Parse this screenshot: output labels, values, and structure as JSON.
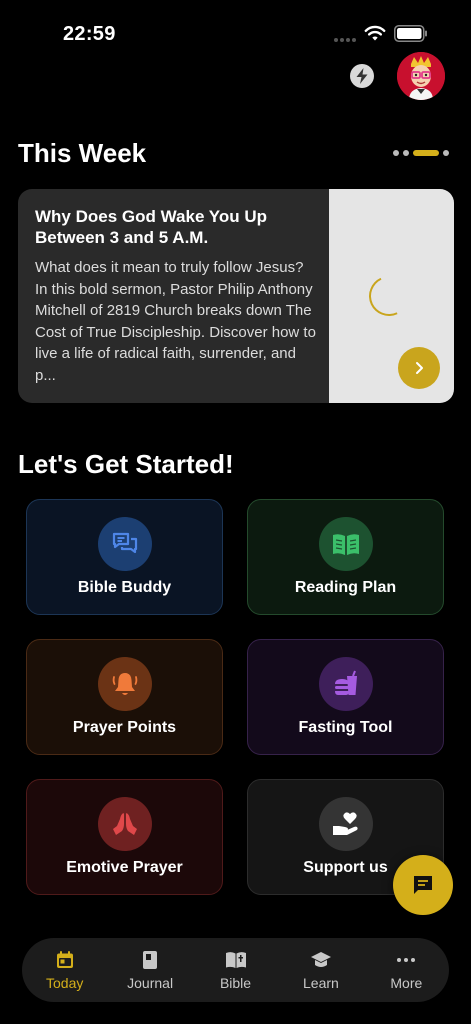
{
  "status_bar": {
    "time": "22:59"
  },
  "header": {
    "bolt_icon": "bolt-icon",
    "avatar_icon": "user-avatar"
  },
  "this_week": {
    "title": "This Week",
    "card": {
      "title": "Why Does God Wake You Up Between 3 and 5 A.M.",
      "description": "What does it mean to truly follow Jesus? In this bold sermon, Pastor Philip Anthony Mitchell of 2819 Church breaks down The Cost of True Discipleship. Discover how to live a life of radical faith, surrender, and p..."
    }
  },
  "get_started": {
    "title": "Let's Get Started!",
    "tiles": [
      {
        "label": "Bible Buddy",
        "icon": "chat-bubbles-icon",
        "color": "#3b6fd6"
      },
      {
        "label": "Reading Plan",
        "icon": "open-book-icon",
        "color": "#3bbf6a"
      },
      {
        "label": "Prayer Points",
        "icon": "bell-icon",
        "color": "#f07a3a"
      },
      {
        "label": "Fasting Tool",
        "icon": "fasting-food-icon",
        "color": "#a55be0"
      },
      {
        "label": "Emotive Prayer",
        "icon": "praying-hands-icon",
        "color": "#e0484a"
      },
      {
        "label": "Support us",
        "icon": "heart-hand-icon",
        "color": "#ffffff"
      }
    ]
  },
  "nav": {
    "items": [
      {
        "label": "Today",
        "icon": "calendar-icon",
        "active": true
      },
      {
        "label": "Journal",
        "icon": "journal-icon",
        "active": false
      },
      {
        "label": "Bible",
        "icon": "bible-icon",
        "active": false
      },
      {
        "label": "Learn",
        "icon": "graduation-cap-icon",
        "active": false
      },
      {
        "label": "More",
        "icon": "more-dots-icon",
        "active": false
      }
    ]
  },
  "colors": {
    "accent": "#d4af1a",
    "background": "#000000"
  }
}
